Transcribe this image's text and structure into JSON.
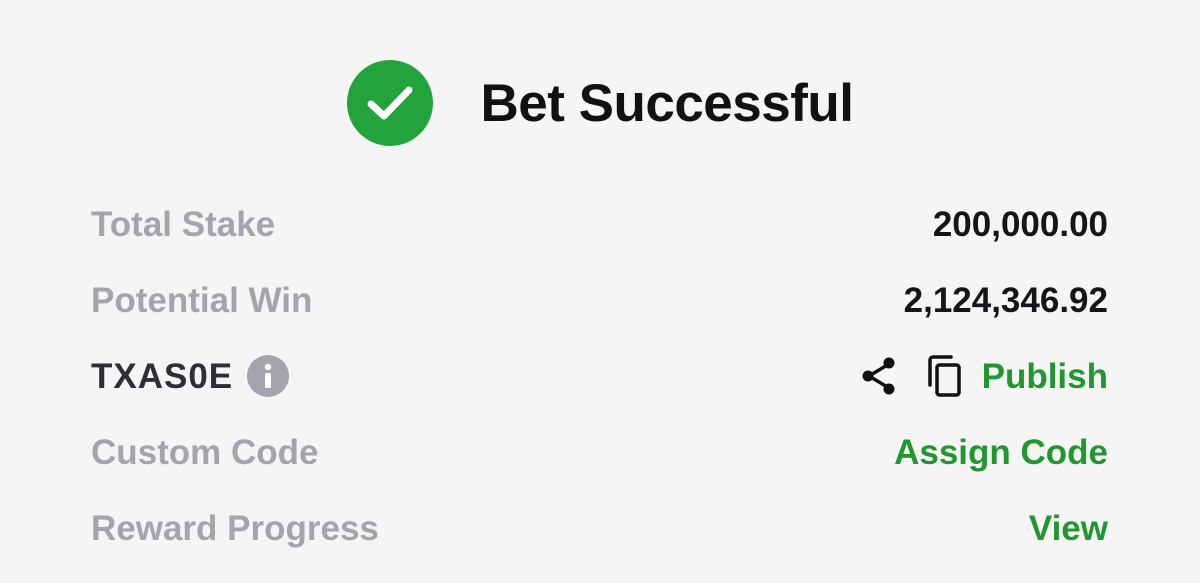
{
  "header": {
    "title": "Bet Successful",
    "status_icon": "check-circle-icon",
    "accent_color": "#22a33b"
  },
  "rows": {
    "total_stake": {
      "label": "Total Stake",
      "value": "200,000.00"
    },
    "potential_win": {
      "label": "Potential Win",
      "value": "2,124,346.92"
    },
    "booking": {
      "code": "TXAS0E",
      "info_icon": "info-icon",
      "share_icon": "share-icon",
      "copy_icon": "copy-icon",
      "publish_label": "Publish"
    },
    "custom_code": {
      "label": "Custom Code",
      "action_label": "Assign Code"
    },
    "reward_progress": {
      "label": "Reward Progress",
      "action_label": "View"
    }
  },
  "colors": {
    "link_green": "#22962f",
    "muted_label": "#a3a4ac",
    "background": "#f5f5f5"
  }
}
